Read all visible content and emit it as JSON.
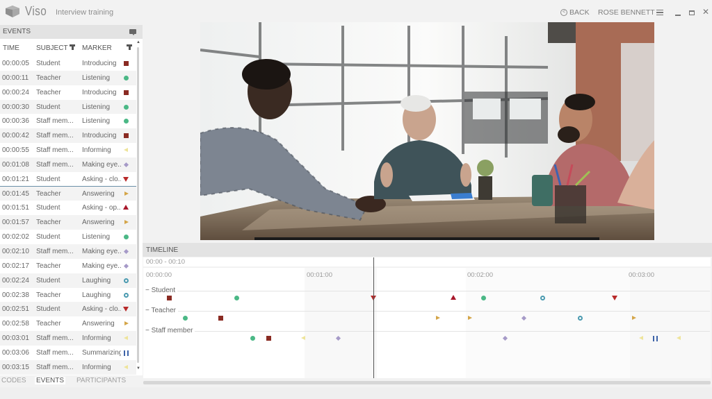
{
  "app": {
    "name": "Viso",
    "project": "Interview training",
    "back_label": "BACK",
    "user": "ROSE BENNETT",
    "icons": {
      "logo": "cube-logo",
      "back": "circle-arrow-left-icon",
      "menu": "hamburger-icon",
      "minimize": "minimize-icon",
      "maximize": "maximize-icon",
      "close": "close-icon"
    },
    "close_glyph": "✕"
  },
  "events": {
    "title": "EVENTS",
    "columns": {
      "time": "TIME",
      "subject": "SUBJECT",
      "marker": "MARKER"
    },
    "rows": [
      {
        "time": "00:00:05",
        "subject": "Student",
        "marker": "Introducing",
        "shape": "square"
      },
      {
        "time": "00:00:11",
        "subject": "Teacher",
        "marker": "Listening",
        "shape": "dot"
      },
      {
        "time": "00:00:24",
        "subject": "Teacher",
        "marker": "Introducing",
        "shape": "square"
      },
      {
        "time": "00:00:30",
        "subject": "Student",
        "marker": "Listening",
        "shape": "dot"
      },
      {
        "time": "00:00:36",
        "subject": "Staff mem...",
        "marker": "Listening",
        "shape": "dot"
      },
      {
        "time": "00:00:42",
        "subject": "Staff mem...",
        "marker": "Introducing",
        "shape": "square"
      },
      {
        "time": "00:00:55",
        "subject": "Staff mem...",
        "marker": "Informing",
        "shape": "left"
      },
      {
        "time": "00:01:08",
        "subject": "Staff mem...",
        "marker": "Making eye...",
        "shape": "diamond"
      },
      {
        "time": "00:01:21",
        "subject": "Student",
        "marker": "Asking - clo...",
        "shape": "down",
        "selected": true
      },
      {
        "time": "00:01:45",
        "subject": "Teacher",
        "marker": "Answering",
        "shape": "right"
      },
      {
        "time": "00:01:51",
        "subject": "Student",
        "marker": "Asking - op...",
        "shape": "up"
      },
      {
        "time": "00:01:57",
        "subject": "Teacher",
        "marker": "Answering",
        "shape": "right"
      },
      {
        "time": "00:02:02",
        "subject": "Student",
        "marker": "Listening",
        "shape": "dot"
      },
      {
        "time": "00:02:10",
        "subject": "Staff mem...",
        "marker": "Making eye...",
        "shape": "diamond"
      },
      {
        "time": "00:02:17",
        "subject": "Teacher",
        "marker": "Making eye...",
        "shape": "diamond"
      },
      {
        "time": "00:02:24",
        "subject": "Student",
        "marker": "Laughing",
        "shape": "ring"
      },
      {
        "time": "00:02:38",
        "subject": "Teacher",
        "marker": "Laughing",
        "shape": "ring"
      },
      {
        "time": "00:02:51",
        "subject": "Student",
        "marker": "Asking - clo...",
        "shape": "down"
      },
      {
        "time": "00:02:58",
        "subject": "Teacher",
        "marker": "Answering",
        "shape": "right"
      },
      {
        "time": "00:03:01",
        "subject": "Staff mem...",
        "marker": "Informing",
        "shape": "left"
      },
      {
        "time": "00:03:06",
        "subject": "Staff mem...",
        "marker": "Summarizing",
        "shape": "pause"
      },
      {
        "time": "00:03:15",
        "subject": "Staff mem...",
        "marker": "Informing",
        "shape": "left"
      }
    ],
    "tabs": [
      {
        "label": "CODES",
        "active": false
      },
      {
        "label": "EVENTS",
        "active": true
      },
      {
        "label": "PARTICIPANTS",
        "active": false
      }
    ]
  },
  "marker_colors": {
    "square": "#8a2b23",
    "dot": "#4bb886",
    "ring": "#4a9ab0",
    "left": "#eee49a",
    "right": "#d4a548",
    "down": "#b82a2a",
    "up": "#a8182b",
    "diamond": "#a69ac8",
    "pause": "#3d63a8"
  },
  "video": {
    "description": "Three men in a meeting at a table by large windows"
  },
  "timeline": {
    "title": "TIMELINE",
    "range": "00:00 - 00:10",
    "ticks": [
      "00:00:00",
      "00:01:00",
      "00:02:00",
      "00:03:00"
    ],
    "playhead_seconds": 81,
    "tracks": [
      {
        "label": "Student",
        "events": [
          {
            "t": 5,
            "shape": "square"
          },
          {
            "t": 30,
            "shape": "dot"
          },
          {
            "t": 81,
            "shape": "down"
          },
          {
            "t": 111,
            "shape": "up"
          },
          {
            "t": 122,
            "shape": "dot"
          },
          {
            "t": 144,
            "shape": "ring"
          },
          {
            "t": 171,
            "shape": "down"
          }
        ]
      },
      {
        "label": "Teacher",
        "events": [
          {
            "t": 11,
            "shape": "dot"
          },
          {
            "t": 24,
            "shape": "square"
          },
          {
            "t": 105,
            "shape": "right"
          },
          {
            "t": 117,
            "shape": "right"
          },
          {
            "t": 137,
            "shape": "diamond"
          },
          {
            "t": 158,
            "shape": "ring"
          },
          {
            "t": 178,
            "shape": "right"
          }
        ]
      },
      {
        "label": "Staff member",
        "events": [
          {
            "t": 36,
            "shape": "dot"
          },
          {
            "t": 42,
            "shape": "square"
          },
          {
            "t": 55,
            "shape": "left"
          },
          {
            "t": 68,
            "shape": "diamond"
          },
          {
            "t": 130,
            "shape": "diamond"
          },
          {
            "t": 181,
            "shape": "left"
          },
          {
            "t": 186,
            "shape": "pause"
          },
          {
            "t": 195,
            "shape": "left"
          }
        ]
      }
    ]
  }
}
